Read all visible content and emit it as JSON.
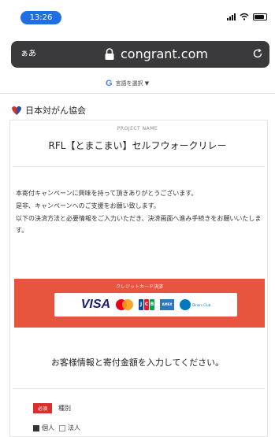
{
  "status_bar": {
    "time": "13:26"
  },
  "browser": {
    "aa_label": "ぁあ",
    "domain": "congrant.com",
    "icons": [
      "lock-icon",
      "reload-icon"
    ]
  },
  "translate_bar": {
    "label": "言語を選択 ▼"
  },
  "org": {
    "name": "日本対がん協会"
  },
  "project": {
    "label": "PROJECT NAME",
    "title": "RFL【とまこまい】セルフウォークリレー"
  },
  "description": [
    "本寄付キャンペーンに興味を持って頂きありがとうございます。",
    "是非、キャンペーンへのご支援をお願い致します。",
    "以下の決済方法と必要情報をご入力いただき、決済画面へ進み手続きをお願いいたします。"
  ],
  "payment": {
    "title": "クレジットカード決済",
    "brands": [
      "VISA",
      "MasterCard",
      "JCB",
      "AMEX",
      "Diners Club"
    ]
  },
  "form": {
    "heading": "お客様情報と寄付金額を入力してください。",
    "required_badge": "必須",
    "field_label": "種別",
    "options": [
      {
        "label": "個人",
        "checked": true
      },
      {
        "label": "法人",
        "checked": false
      }
    ]
  },
  "colors": {
    "time_pill": "#1e6ee6",
    "url_bar": "#3a3a3c",
    "payment_banner": "#e8553f",
    "required_badge": "#d9302e"
  }
}
